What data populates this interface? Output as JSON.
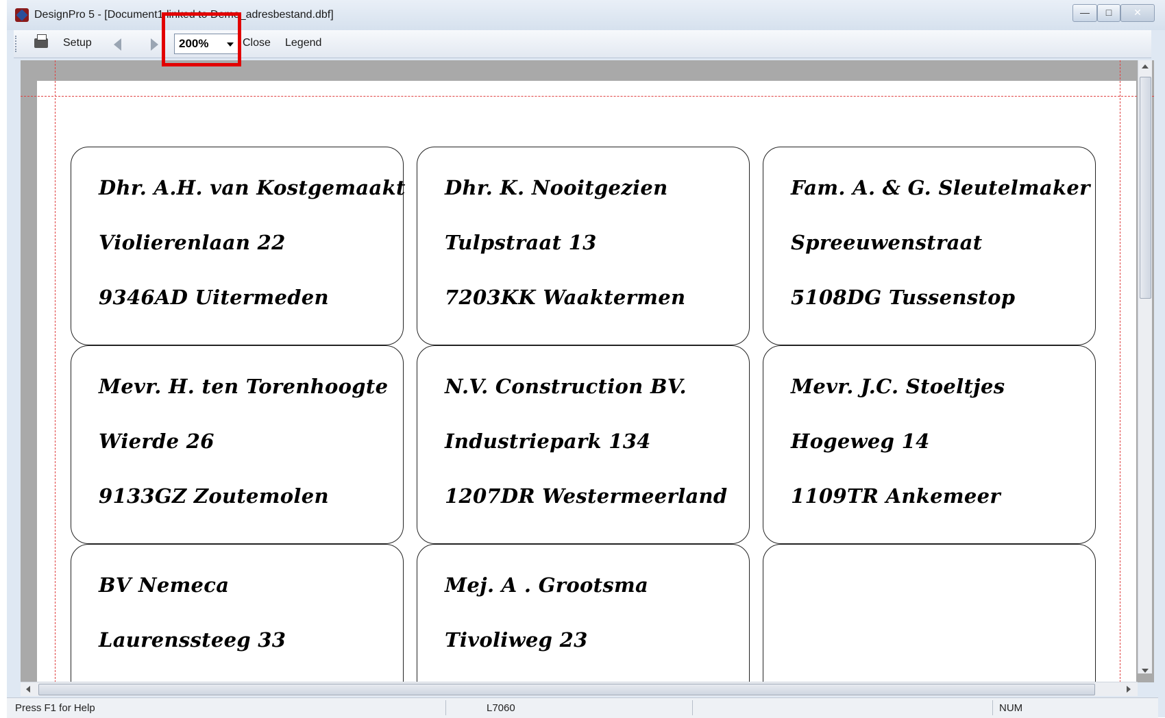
{
  "window": {
    "title": "DesignPro 5 - [Document1 linked to Demo_adresbestand.dbf]",
    "minimize": "—",
    "maximize": "□",
    "close": "✕"
  },
  "toolbar": {
    "print_icon": "printer-icon",
    "setup": "Setup",
    "zoom": "200%",
    "close": "Close",
    "legend": "Legend"
  },
  "labels": [
    {
      "lines": [
        "Dhr. A.H. van Kostgemaakt",
        "Violierenlaan 22",
        "9346AD  Uitermeden"
      ]
    },
    {
      "lines": [
        "Dhr. K.  Nooitgezien",
        "Tulpstraat 13",
        "7203KK  Waaktermen"
      ]
    },
    {
      "lines": [
        "Fam. A. & G.  Sleutelmaker",
        "Spreeuwenstraat",
        "5108DG  Tussenstop"
      ]
    },
    {
      "lines": [
        "Mevr. H. ten Torenhoogte",
        "Wierde 26",
        "9133GZ  Zoutemolen"
      ]
    },
    {
      "lines": [
        "N.V.   Construction BV.",
        "Industriepark 134",
        "1207DR  Westermeerland"
      ]
    },
    {
      "lines": [
        "Mevr. J.C.  Stoeltjes",
        "Hogeweg 14",
        "1109TR  Ankemeer"
      ]
    },
    {
      "lines": [
        "BV   Nemeca",
        "Laurenssteeg 33",
        ""
      ]
    },
    {
      "lines": [
        "Mej. A .  Grootsma",
        "Tivoliweg 23",
        ""
      ]
    },
    {
      "lines": [
        "",
        "",
        ""
      ]
    }
  ],
  "status": {
    "help": "Press F1 for Help",
    "label_type": "L7060",
    "num": "NUM"
  }
}
